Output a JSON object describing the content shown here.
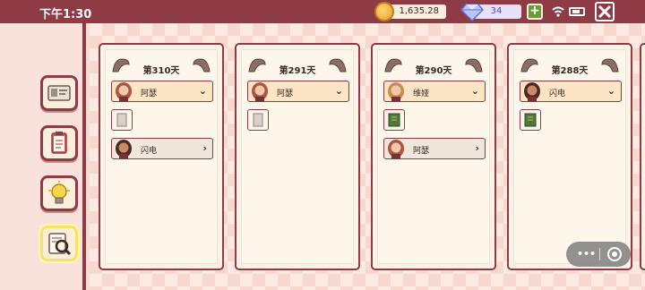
{
  "status_bar": {
    "time": "下午1:30"
  },
  "currency": {
    "coins": "1,635.28",
    "gems": "34",
    "add_label": "+"
  },
  "sidebar": {
    "items": [
      {
        "name": "id-card-tab",
        "icon": "id-card-icon"
      },
      {
        "name": "clipboard-tab",
        "icon": "clipboard-icon"
      },
      {
        "name": "lightbulb-tab",
        "icon": "lightbulb-icon"
      },
      {
        "name": "case-search-tab",
        "icon": "notebook-magnifier-icon",
        "active": true
      }
    ]
  },
  "cards": [
    {
      "day": "第310天",
      "selector": {
        "name": "阿瑟",
        "hair": "#a95643"
      },
      "items": [
        "paper"
      ],
      "next": {
        "name": "闪电",
        "hair": "#4a2a22"
      }
    },
    {
      "day": "第291天",
      "selector": {
        "name": "阿瑟",
        "hair": "#a95643"
      },
      "items": [
        "paper"
      ],
      "next": null
    },
    {
      "day": "第290天",
      "selector": {
        "name": "维娅",
        "hair": "#c98a57"
      },
      "items": [
        "book"
      ],
      "next": {
        "name": "阿瑟",
        "hair": "#a95643"
      }
    },
    {
      "day": "第288天",
      "selector": {
        "name": "闪电",
        "hair": "#4a2a22"
      },
      "items": [
        "book"
      ],
      "next": null
    }
  ],
  "overlay": {
    "dots": "•••"
  },
  "colors": {
    "accent": "#8e3b45",
    "card_bg": "#fdf6ea",
    "selector_bg": "#fbe5c4"
  }
}
